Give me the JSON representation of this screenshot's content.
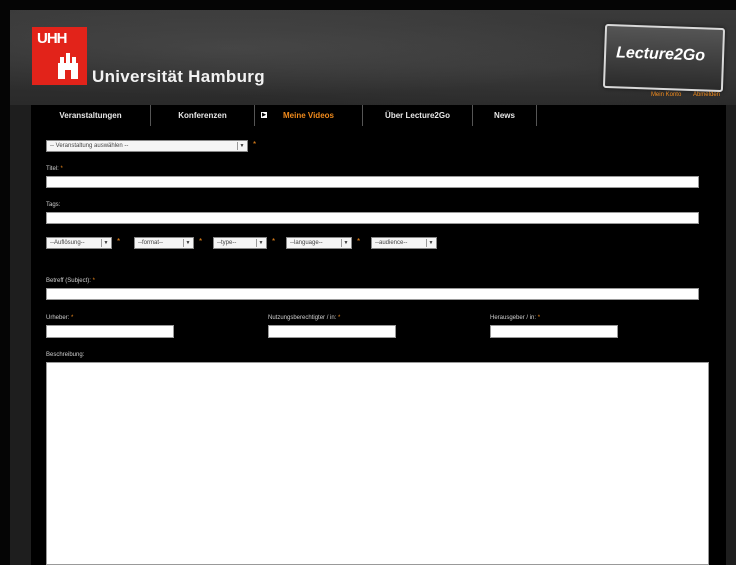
{
  "header": {
    "logo_letters": "UHH",
    "university_name": "Universität Hamburg",
    "brand_logo": "Lecture2Go",
    "top_links": [
      "Mein Konto",
      "Abmelden"
    ]
  },
  "nav": {
    "items": [
      {
        "label": "Veranstaltungen"
      },
      {
        "label": "Konferenzen"
      },
      {
        "label": "Meine Videos"
      },
      {
        "label": "Über Lecture2Go"
      },
      {
        "label": "News"
      }
    ]
  },
  "form": {
    "event_select": "-- Veranstaltung auswählen --",
    "required_mark": "*",
    "title_label": "Titel:",
    "tags_label": "Tags:",
    "dropdowns": [
      "--Auflösung--",
      "--format--",
      "--type--",
      "--language--",
      "--audience--"
    ],
    "subject_label": "Betreff (Subject):",
    "author_label": "Urheber:",
    "rights_label": "Nutzungsberechtigter / in:",
    "publisher_label": "Herausgeber / in:",
    "description_label": "Beschreibung:"
  },
  "colors": {
    "accent": "#f08a1c",
    "uhh_red": "#e2231a",
    "page_bg": "#000000"
  }
}
